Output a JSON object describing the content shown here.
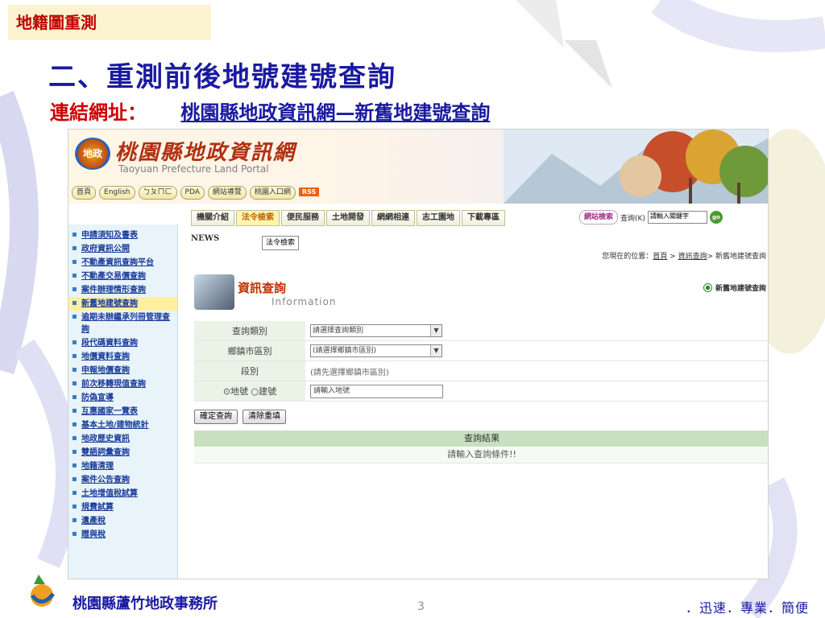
{
  "slide": {
    "tag": "地籍圖重測",
    "title": "二、重測前後地號建號查詢",
    "link_label": "連結網址：",
    "link_text": "桃園縣地政資訊網—新舊地建號查詢"
  },
  "portal": {
    "logo_text": "地政",
    "name_cn": "桃園縣地政資訊網",
    "name_en": "Taoyuan Prefecture Land Portal",
    "quick_links": [
      "首頁",
      "English",
      "ㄅㄆㄇㄈ",
      "PDA",
      "網站導覽",
      "桃園入口網"
    ],
    "rss": "RSS",
    "nav": [
      "機關介紹",
      "法令檢索",
      "便民服務",
      "土地開發",
      "網網相連",
      "志工園地",
      "下載專區"
    ],
    "nav_active_index": 1,
    "search": {
      "label": "網站檢索",
      "text": "查詢(K)",
      "placeholder": "請輸入關鍵字",
      "go": "go"
    }
  },
  "sidebar": {
    "items": [
      "申請須知及書表",
      "政府資訊公開",
      "不動產資訊查詢平台",
      "不動產交易價查詢",
      "案件辦理情形查詢",
      "新舊地建號查詢",
      "逾期未辦繼承列冊管理查詢",
      "段代碼資料查詢",
      "地價資料查詢",
      "申報地價查詢",
      "前次移轉現值查詢",
      "防偽宣導",
      "互惠國家一覽表",
      "基本土地/建物統計",
      "地政歷史資訊",
      "雙語詞彙查詢",
      "地籍清理",
      "案件公告查詢",
      "土地增值稅試算",
      "規費試算",
      "遺產稅",
      "贈與稅"
    ],
    "active_index": 5
  },
  "content": {
    "news": "NEWS",
    "law_button": "法令檢索",
    "breadcrumb": {
      "prefix": "您現在的位置：",
      "home": "首頁",
      "sep1": " > ",
      "section": "資訊查詢",
      "sep2": "> ",
      "page": "新舊地建號查詢"
    },
    "info_title": "資訊查詢",
    "info_sub": "Information",
    "info_right": "新舊地建號查詢",
    "form": {
      "type_label": "查詢類別",
      "type_value": "請選擇查詢類別",
      "town_label": "鄉鎮市區別",
      "town_value": "(請選擇鄉鎮市區別)",
      "section_label": "段別",
      "section_hint": "(請先選擇鄉鎮市區別)",
      "radio_land": "地號",
      "radio_building": "建號",
      "number_value": "請輸入地號"
    },
    "buttons": {
      "submit": "確定查詢",
      "reset": "清除重填"
    },
    "result_header": "查詢結果",
    "result_text": "請輸入查詢條件!!"
  },
  "footer": {
    "office": "桃園縣蘆竹地政事務所",
    "page": "3",
    "slogan": "．迅速．專業．簡便"
  }
}
